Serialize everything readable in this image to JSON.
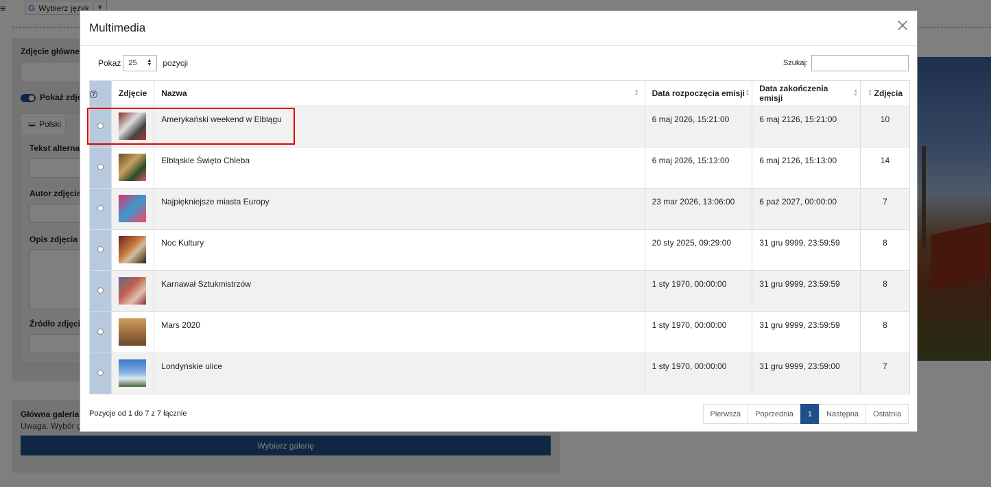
{
  "topbar": {
    "menu_icon": "≡",
    "language_label": "Wybierz język",
    "google_glyph": "G",
    "dropdown_glyph": "▼"
  },
  "background": {
    "main_photo_label": "Zdjęcie główne",
    "show_photo_label": "Pokaż zdję",
    "tab_polish": "Polski",
    "alt_text_label": "Tekst alternat",
    "author_label": "Autor zdjęcia",
    "description_label": "Opis zdjęcia",
    "source_label": "Źródło zdjęci",
    "gallery_title": "Główna galeria z",
    "gallery_note": "Uwaga. Wybór gł",
    "choose_gallery_button": "Wybierz galerię"
  },
  "modal": {
    "title": "Multimedia",
    "show_label": "Pokaż",
    "page_size": "25",
    "entries_label": "pozycji",
    "search_label": "Szukaj:",
    "search_value": "",
    "columns": {
      "help": "?",
      "photo": "Zdjęcie",
      "name": "Nazwa",
      "start_date": "Data rozpoczęcia emisji",
      "end_date": "Data zakończenia emisji",
      "photos_count": "Zdjęcia"
    },
    "rows": [
      {
        "name": "Amerykański weekend w Elblągu",
        "start": "6 maj 2026, 15:21:00",
        "end": "6 maj 2126, 15:21:00",
        "count": "10"
      },
      {
        "name": "Elbląskie Święto Chleba",
        "start": "6 maj 2026, 15:13:00",
        "end": "6 maj 2126, 15:13:00",
        "count": "14"
      },
      {
        "name": "Najpiękniejsze miasta Europy",
        "start": "23 mar 2026, 13:06:00",
        "end": "6 paź 2027, 00:00:00",
        "count": "7"
      },
      {
        "name": "Noc Kultury",
        "start": "20 sty 2025, 09:29:00",
        "end": "31 gru 9999, 23:59:59",
        "count": "8"
      },
      {
        "name": "Karnawał Sztukmistrzów",
        "start": "1 sty 1970, 00:00:00",
        "end": "31 gru 9999, 23:59:59",
        "count": "8"
      },
      {
        "name": "Mars 2020",
        "start": "1 sty 1970, 00:00:00",
        "end": "31 gru 9999, 23:59:59",
        "count": "8"
      },
      {
        "name": "Londyńskie ulice",
        "start": "1 sty 1970, 00:00:00",
        "end": "31 gru 9999, 23:59:00",
        "count": "7"
      }
    ],
    "info": "Pozycje od 1 do 7 z 7 łącznie",
    "pagination": {
      "first": "Pierwsza",
      "previous": "Poprzednia",
      "current": "1",
      "next": "Następna",
      "last": "Ostatnia"
    }
  },
  "colors": {
    "accent": "#1f4f8b",
    "highlight": "#e00000",
    "radio_column": "#b7c9df"
  }
}
